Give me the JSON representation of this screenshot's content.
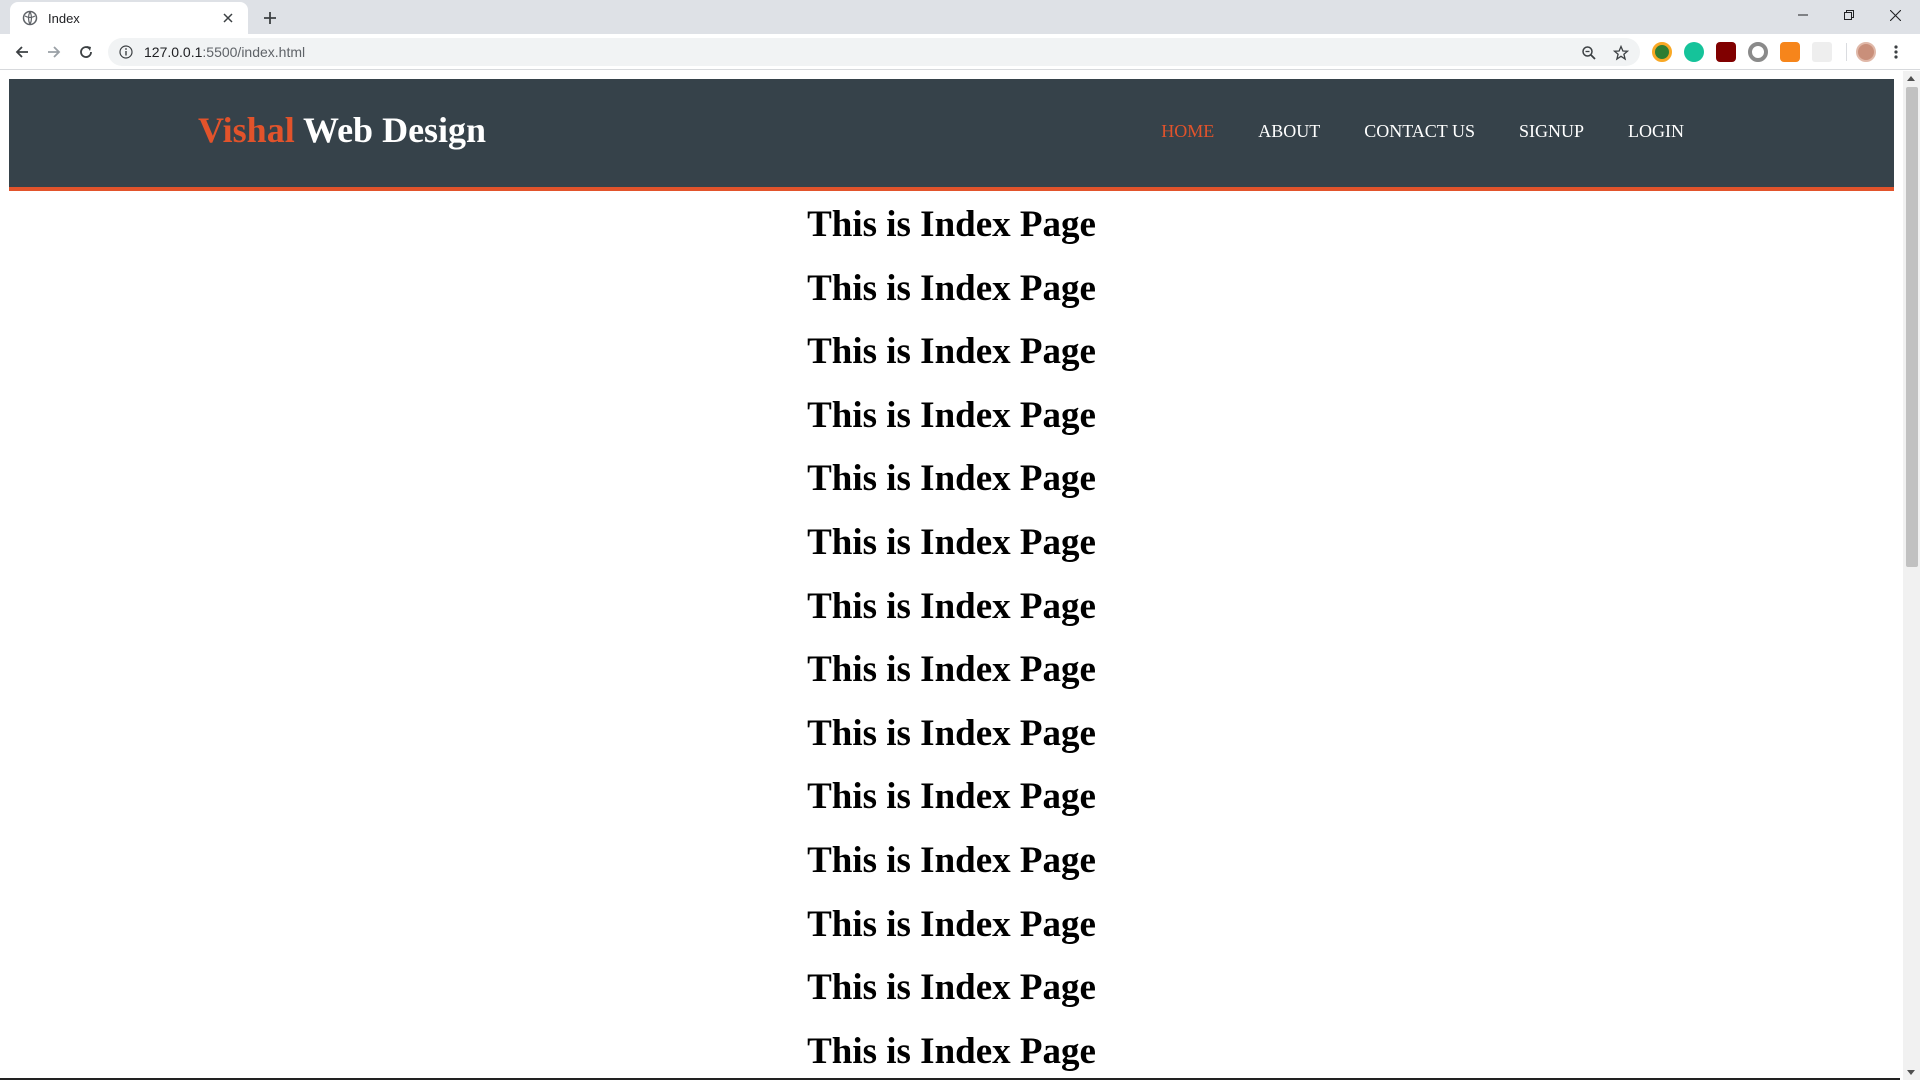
{
  "browser": {
    "tab_title": "Index",
    "url_host": "127.0.0.1",
    "url_path": ":5500/index.html"
  },
  "site": {
    "logo_accent": "Vishal",
    "logo_rest": " Web Design",
    "nav": [
      {
        "label": "HOME",
        "active": true
      },
      {
        "label": "ABOUT",
        "active": false
      },
      {
        "label": "CONTACT US",
        "active": false
      },
      {
        "label": "SIGNUP",
        "active": false
      },
      {
        "label": "LOGIN",
        "active": false
      }
    ],
    "headings": [
      "This is Index Page",
      "This is Index Page",
      "This is Index Page",
      "This is Index Page",
      "This is Index Page",
      "This is Index Page",
      "This is Index Page",
      "This is Index Page",
      "This is Index Page",
      "This is Index Page",
      "This is Index Page",
      "This is Index Page",
      "This is Index Page",
      "This is Index Page"
    ]
  },
  "colors": {
    "header_bg": "#36424a",
    "accent": "#e2532b"
  },
  "icons": {
    "tab_favicon": "globe-icon",
    "tab_close": "close-icon",
    "new_tab": "plus-icon",
    "back": "back-arrow-icon",
    "forward": "forward-arrow-icon",
    "reload": "reload-icon",
    "site_info": "info-icon",
    "zoom": "zoom-icon",
    "bookmark": "star-icon",
    "menu": "kebab-menu-icon"
  }
}
